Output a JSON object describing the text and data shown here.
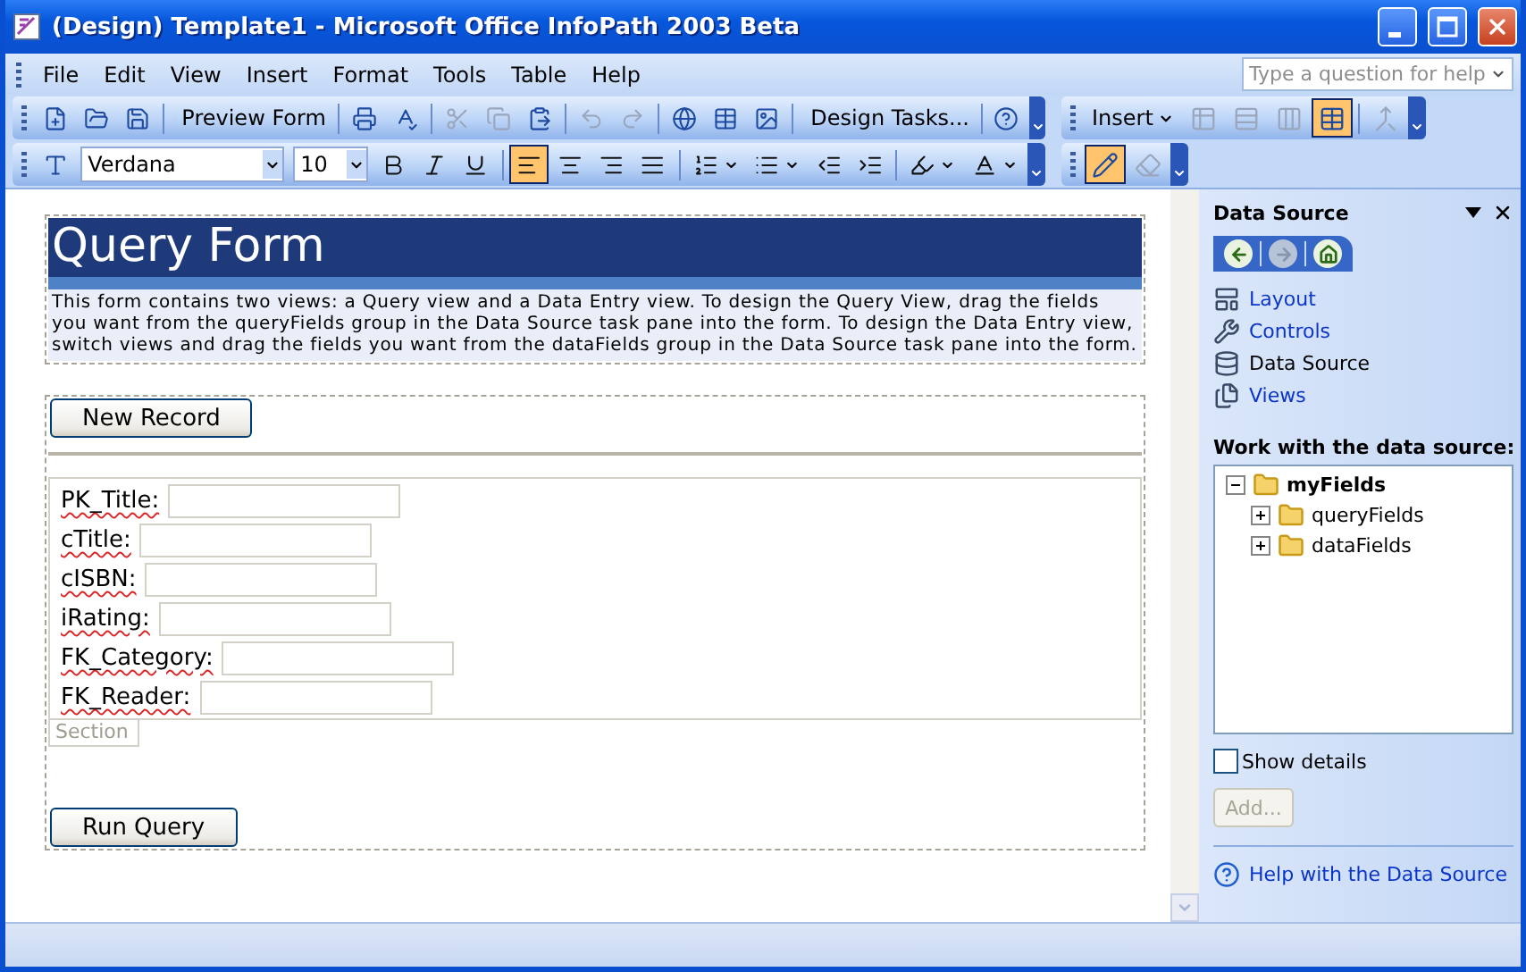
{
  "window": {
    "title": "(Design) Template1 - Microsoft Office InfoPath 2003 Beta"
  },
  "menu": [
    "File",
    "Edit",
    "View",
    "Insert",
    "Format",
    "Tools",
    "Table",
    "Help"
  ],
  "help_box": {
    "placeholder": "Type a question for help"
  },
  "standard_toolbar": [
    {
      "kind": "icon",
      "disabled": false
    },
    {
      "kind": "icon",
      "disabled": false
    },
    {
      "kind": "icon",
      "disabled": false
    },
    {
      "kind": "separator"
    },
    {
      "kind": "text",
      "label": "Preview Form",
      "disabled": false
    },
    {
      "kind": "separator"
    },
    {
      "kind": "icon",
      "disabled": false
    },
    {
      "kind": "icon",
      "disabled": false
    },
    {
      "kind": "separator"
    },
    {
      "kind": "icon",
      "disabled": true
    },
    {
      "kind": "icon",
      "disabled": true
    },
    {
      "kind": "icon",
      "disabled": false
    },
    {
      "kind": "separator"
    },
    {
      "kind": "icon",
      "disabled": true
    },
    {
      "kind": "icon",
      "disabled": true
    },
    {
      "kind": "separator"
    },
    {
      "kind": "icon",
      "disabled": false
    },
    {
      "kind": "icon",
      "disabled": false
    },
    {
      "kind": "icon",
      "disabled": false
    },
    {
      "kind": "separator"
    },
    {
      "kind": "text",
      "label": "Design Tasks...",
      "disabled": false
    },
    {
      "kind": "separator"
    },
    {
      "kind": "icon",
      "disabled": false
    }
  ],
  "layout_toolbar": {
    "menu": "Insert",
    "buttons": [
      {
        "disabled": true,
        "selected": false
      },
      {
        "disabled": true,
        "selected": false
      },
      {
        "disabled": true,
        "selected": false
      },
      {
        "disabled": false,
        "selected": true
      },
      {
        "kind": "separator"
      },
      {
        "disabled": true,
        "selected": false
      }
    ]
  },
  "formatting_toolbar": {
    "font": "Verdana",
    "size": "10",
    "buttons": [
      {
        "kind": "icon",
        "selected": false
      },
      {
        "kind": "icon",
        "selected": false
      },
      {
        "kind": "icon",
        "selected": false
      },
      {
        "kind": "separator"
      },
      {
        "kind": "icon",
        "selected": true
      },
      {
        "kind": "icon",
        "selected": false
      },
      {
        "kind": "icon",
        "selected": false
      },
      {
        "kind": "icon",
        "selected": false
      },
      {
        "kind": "separator"
      },
      {
        "kind": "dropdown",
        "selected": false
      },
      {
        "kind": "dropdown",
        "selected": false
      },
      {
        "kind": "icon",
        "selected": false
      },
      {
        "kind": "icon",
        "selected": false
      },
      {
        "kind": "separator"
      },
      {
        "kind": "dropdown",
        "selected": false
      },
      {
        "kind": "dropdown",
        "selected": false
      }
    ]
  },
  "drawing_toolbar": [
    {
      "selected": true,
      "disabled": false
    },
    {
      "selected": false,
      "disabled": true
    }
  ],
  "form": {
    "title": "Query Form",
    "description": "This form contains two views: a Query view and a Data Entry view. To design the Query View, drag the fields you want from the queryFields group in the Data Source task pane into the form. To design the Data Entry view, switch views and drag the fields you want from the dataFields group in the Data Source task pane into the form.",
    "new_button": "New Record",
    "fields": [
      {
        "label": "PK_Title:",
        "misspelled": true
      },
      {
        "label": "cTitle:",
        "misspelled": true
      },
      {
        "label": "cISBN:",
        "misspelled": true
      },
      {
        "label": "iRating:",
        "misspelled": true
      },
      {
        "label": "FK_Category:",
        "misspelled": true
      },
      {
        "label": "FK_Reader:",
        "misspelled": true
      }
    ],
    "section_label": "Section",
    "run_button": "Run Query"
  },
  "task_pane": {
    "title": "Data Source",
    "nav": [
      {
        "disabled": false
      },
      {
        "disabled": true
      },
      {
        "disabled": false
      }
    ],
    "links": [
      {
        "label": "Layout",
        "selected": false
      },
      {
        "label": "Controls",
        "selected": false
      },
      {
        "label": "Data Source",
        "selected": true
      },
      {
        "label": "Views",
        "selected": false
      }
    ],
    "heading": "Work with the data source:",
    "tree": [
      {
        "label": "myFields",
        "expanded": true,
        "children": [
          {
            "label": "queryFields",
            "expanded": false
          },
          {
            "label": "dataFields",
            "expanded": false
          }
        ]
      }
    ],
    "show_details": {
      "label": "Show details",
      "checked": false
    },
    "add_button": {
      "label": "Add...",
      "disabled": true
    },
    "help_link": "Help with the Data Source"
  }
}
